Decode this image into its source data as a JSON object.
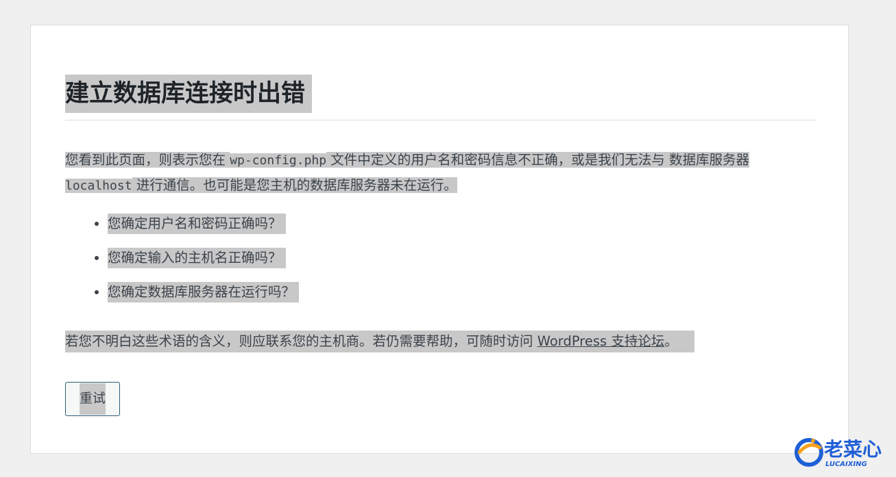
{
  "title": "建立数据库连接时出错",
  "intro": {
    "part1": "您看到此页面，则表示您在 ",
    "code1": "wp-config.php",
    "part2": " 文件中定义的用户名和密码信息不正确，或是我们无法与 数据库服务器 ",
    "code2": "localhost",
    "part3": " 进行通信。也可能是您主机的数据库服务器未在运行。"
  },
  "checklist": [
    "您确定用户名和密码正确吗？",
    "您确定输入的主机名正确吗？",
    "您确定数据库服务器在运行吗？"
  ],
  "help": {
    "text": "若您不明白这些术语的含义，则应联系您的主机商。若仍需要帮助，可随时访问 ",
    "link_label": "WordPress 支持论坛",
    "suffix": "。"
  },
  "retry_button": "重试",
  "watermark": {
    "name": "老菜心",
    "subtitle": "LUCAIXING"
  },
  "colors": {
    "highlight": "#c8c8c8",
    "page_bg": "#f0f0f1",
    "card_bg": "#ffffff",
    "button_border": "#2a5d7a",
    "watermark_blue": "#1f5fd6",
    "watermark_orange": "#f7a21b"
  }
}
